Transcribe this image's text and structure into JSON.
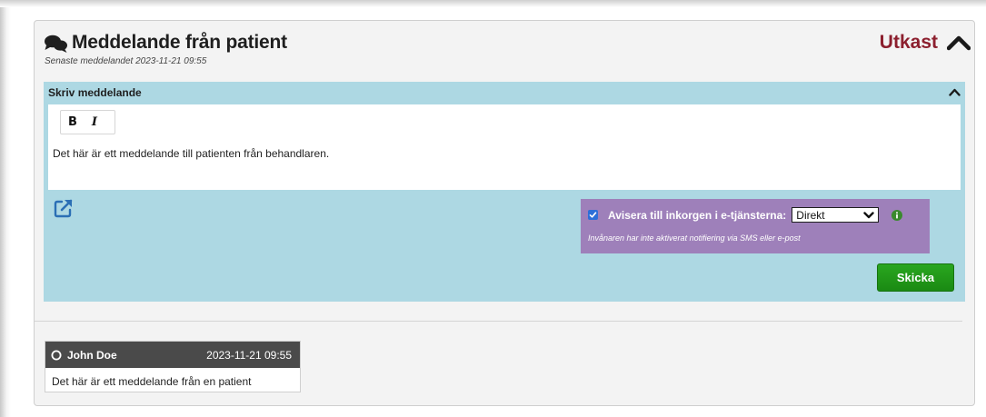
{
  "header": {
    "title": "Meddelande från patient",
    "last_message": "Senaste meddelandet 2023-11-21 09:55",
    "status": "Utkast",
    "status_color": "#8c1f2e"
  },
  "compose": {
    "label": "Skriv meddelande",
    "toolbar": {
      "bold": "B",
      "italic": "I"
    },
    "text": "Det här är ett meddelande till patienten från behandlaren.",
    "notify": {
      "checked": true,
      "label": "Avisera till inkorgen i e-tjänsterna:",
      "selected": "Direkt",
      "note": "Invånaren har inte aktiverat notifiering via SMS eller e-post"
    },
    "send_label": "Skicka"
  },
  "messages": [
    {
      "author": "John Doe",
      "date": "2023-11-21 09:55",
      "body": "Det här är ett meddelande från en patient"
    }
  ],
  "icons": {
    "chat": "chat-bubbles-icon",
    "collapse": "chevron-up-icon",
    "external": "external-link-icon",
    "info": "info-icon",
    "radio": "radio-icon"
  },
  "colors": {
    "compose_bg": "#add8e3",
    "notify_bg": "#9e80ba",
    "send_bg": "#1f9a18",
    "message_head_bg": "#4a4a4a"
  }
}
